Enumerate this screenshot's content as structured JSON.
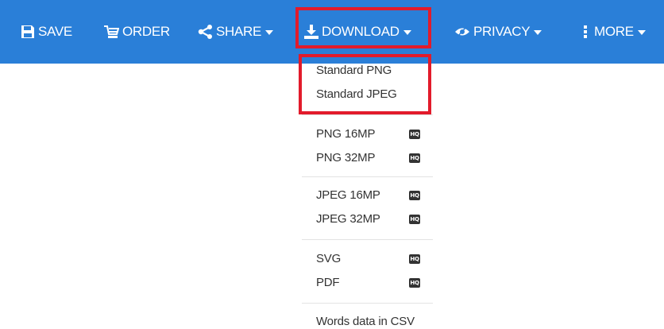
{
  "toolbar": {
    "background": "#2a7fd8",
    "items": [
      {
        "label": "SAVE",
        "icon": "save-icon"
      },
      {
        "label": "ORDER",
        "icon": "cart-icon"
      },
      {
        "label": "SHARE",
        "icon": "share-icon",
        "dropdown": true
      },
      {
        "label": "DOWNLOAD",
        "icon": "download-icon",
        "dropdown": true,
        "highlighted": true
      },
      {
        "label": "PRIVACY",
        "icon": "eye-icon",
        "dropdown": true
      },
      {
        "label": "MORE",
        "icon": "vertical-dots-icon",
        "dropdown": true
      }
    ]
  },
  "download_menu": {
    "badge": "HQ",
    "groups": [
      {
        "highlighted": true,
        "items": [
          {
            "label": "Standard PNG",
            "hq": false
          },
          {
            "label": "Standard JPEG",
            "hq": false
          }
        ]
      },
      {
        "items": [
          {
            "label": "PNG 16MP",
            "hq": true
          },
          {
            "label": "PNG 32MP",
            "hq": true
          }
        ]
      },
      {
        "items": [
          {
            "label": "JPEG 16MP",
            "hq": true
          },
          {
            "label": "JPEG 32MP",
            "hq": true
          }
        ]
      },
      {
        "items": [
          {
            "label": "SVG",
            "hq": true
          },
          {
            "label": "PDF",
            "hq": true
          }
        ]
      },
      {
        "items": [
          {
            "label": "Words data in CSV",
            "hq": false
          }
        ]
      }
    ]
  },
  "highlight_color": "#e21b2b"
}
